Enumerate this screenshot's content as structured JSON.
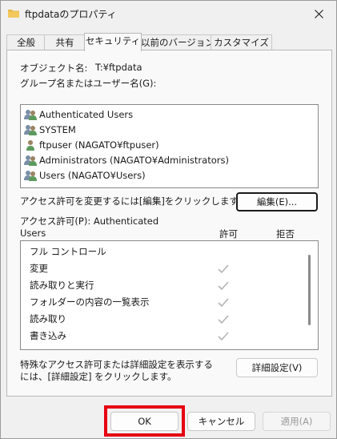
{
  "window": {
    "title": "ftpdataのプロパティ"
  },
  "tabs": [
    {
      "label": "全般"
    },
    {
      "label": "共有"
    },
    {
      "label": "セキュリティ"
    },
    {
      "label": "以前のバージョン"
    },
    {
      "label": "カスタマイズ"
    }
  ],
  "security": {
    "object_name_label": "オブジェクト名:",
    "object_name_value": "T:¥ftpdata",
    "group_label": "グループ名またはユーザー名(G):",
    "principals": [
      {
        "name": "Authenticated Users",
        "icon": "users-icon"
      },
      {
        "name": "SYSTEM",
        "icon": "users-icon"
      },
      {
        "name": "ftpuser (NAGATO¥ftpuser)",
        "icon": "user-icon"
      },
      {
        "name": "Administrators (NAGATO¥Administrators)",
        "icon": "users-icon"
      },
      {
        "name": "Users (NAGATO¥Users)",
        "icon": "users-icon"
      }
    ],
    "edit_hint": "アクセス許可を変更するには[編集]をクリックします。",
    "edit_button": "編集(E)...",
    "perm_label_line1": "アクセス許可(P): Authenticated",
    "perm_label_line2": "Users",
    "allow_header": "許可",
    "deny_header": "拒否",
    "permissions": [
      {
        "name": "フル コントロール",
        "allow": false,
        "deny": false
      },
      {
        "name": "変更",
        "allow": true,
        "deny": false
      },
      {
        "name": "読み取りと実行",
        "allow": true,
        "deny": false
      },
      {
        "name": "フォルダーの内容の一覧表示",
        "allow": true,
        "deny": false
      },
      {
        "name": "読み取り",
        "allow": true,
        "deny": false
      },
      {
        "name": "書き込み",
        "allow": true,
        "deny": false
      }
    ],
    "advanced_hint_line1": "特殊なアクセス許可または詳細設定を表示する",
    "advanced_hint_line2": "には、[詳細設定] をクリックします。",
    "advanced_button": "詳細設定(V)"
  },
  "footer": {
    "ok": "OK",
    "cancel": "キャンセル",
    "apply": "適用(A)"
  },
  "colors": {
    "highlight": "#e60012",
    "folder": "#e8b84a",
    "check": "#b4b4b4"
  }
}
